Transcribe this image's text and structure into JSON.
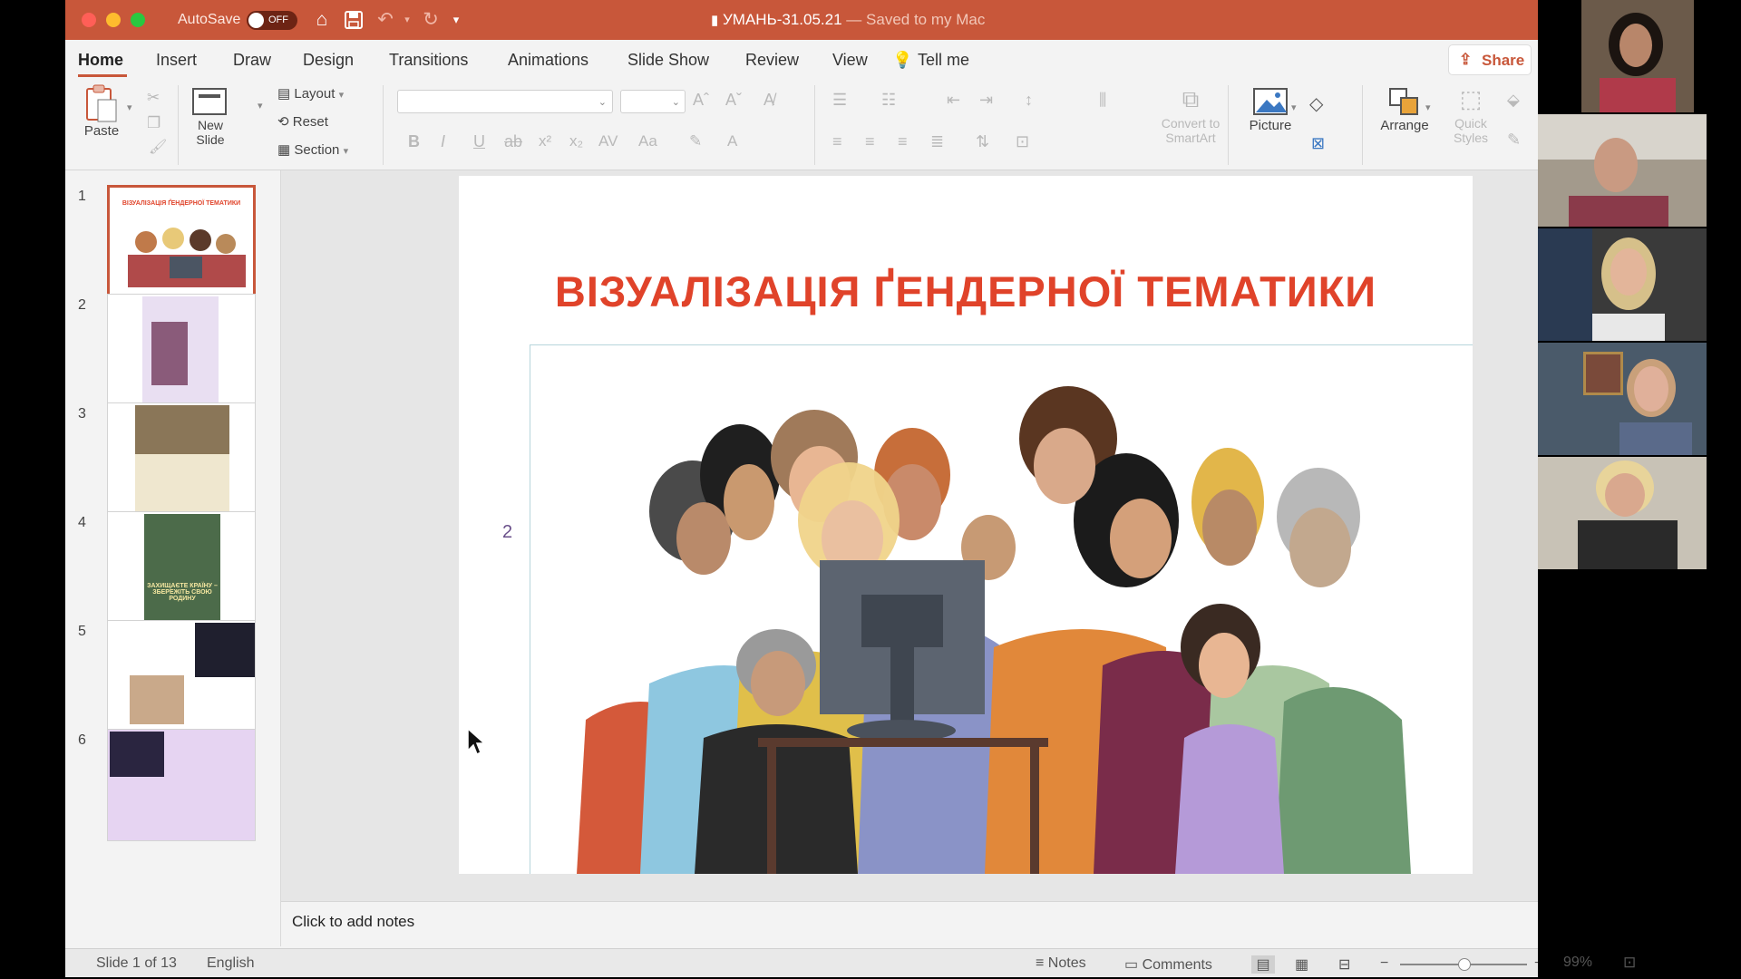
{
  "window": {
    "autosave_label": "AutoSave",
    "autosave_state": "OFF",
    "doc_name": "УМАНЬ-31.05.21",
    "doc_status": " — Saved to my Mac"
  },
  "tabs": [
    {
      "label": "Home"
    },
    {
      "label": "Insert"
    },
    {
      "label": "Draw"
    },
    {
      "label": "Design"
    },
    {
      "label": "Transitions"
    },
    {
      "label": "Animations"
    },
    {
      "label": "Slide Show"
    },
    {
      "label": "Review"
    },
    {
      "label": "View"
    },
    {
      "label": "Tell me"
    }
  ],
  "share_label": "Share",
  "ribbon": {
    "paste": "Paste",
    "new_slide_1": "New",
    "new_slide_2": "Slide",
    "layout": "Layout",
    "reset": "Reset",
    "section": "Section",
    "convert_1": "Convert to",
    "convert_2": "SmartArt",
    "picture": "Picture",
    "arrange": "Arrange",
    "quick_1": "Quick",
    "quick_2": "Styles"
  },
  "thumbnails": [
    {
      "num": "1",
      "title": "ВІЗУАЛІЗАЦІЯ ҐЕНДЕРНОЇ ТЕМАТИКИ"
    },
    {
      "num": "2"
    },
    {
      "num": "3"
    },
    {
      "num": "4",
      "caption": "ЗАХИЩАЄТЕ КРАЇНУ – ЗБЕРЕЖІТЬ СВОЮ РОДИНУ"
    },
    {
      "num": "5"
    },
    {
      "num": "6"
    }
  ],
  "slide": {
    "title": "ВІЗУАЛІЗАЦІЯ   ҐЕНДЕРНОЇ ТЕМАТИКИ",
    "placeholder_number": "2"
  },
  "notes_placeholder": "Click to add notes",
  "status": {
    "slide_counter": "Slide 1 of 13",
    "language": "English",
    "notes": "Notes",
    "comments": "Comments",
    "zoom": "99%"
  },
  "colors": {
    "titlebar": "#c8573a",
    "accent": "#c8573a",
    "slide_title": "#e0432a"
  }
}
